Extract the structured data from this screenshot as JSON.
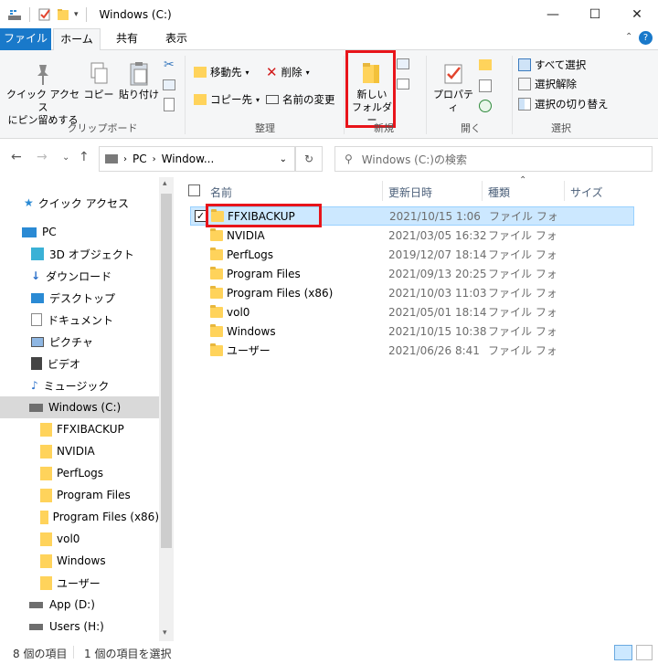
{
  "window": {
    "title": "Windows (C:)"
  },
  "tabs": {
    "file": "ファイル",
    "home": "ホーム",
    "share": "共有",
    "view": "表示"
  },
  "ribbon": {
    "clipboard": {
      "pin_line1": "クイック アクセス",
      "pin_line2": "にピン留めする",
      "copy": "コピー",
      "paste": "貼り付け",
      "label": "クリップボード"
    },
    "organize": {
      "move": "移動先",
      "copy_to": "コピー先",
      "delete": "削除",
      "rename": "名前の変更",
      "label": "整理"
    },
    "new": {
      "folder_line1": "新しい",
      "folder_line2": "フォルダー",
      "label": "新規"
    },
    "open": {
      "properties": "プロパティ",
      "label": "開く"
    },
    "select": {
      "all": "すべて選択",
      "none": "選択解除",
      "invert": "選択の切り替え",
      "label": "選択"
    }
  },
  "address": {
    "path": [
      "PC",
      "Window..."
    ],
    "search_placeholder": "Windows (C:)の検索"
  },
  "nav": {
    "quick_access": "クイック アクセス",
    "pc": "PC",
    "items": [
      "3D オブジェクト",
      "ダウンロード",
      "デスクトップ",
      "ドキュメント",
      "ピクチャ",
      "ビデオ",
      "ミュージック"
    ],
    "drive_c": "Windows (C:)",
    "drive_c_children": [
      "FFXIBACKUP",
      "NVIDIA",
      "PerfLogs",
      "Program Files",
      "Program Files (x86)",
      "vol0",
      "Windows",
      "ユーザー"
    ],
    "drive_d": "App (D:)",
    "drive_h": "Users (H:)"
  },
  "columns": {
    "name": "名前",
    "date": "更新日時",
    "type": "種類",
    "size": "サイズ"
  },
  "files": [
    {
      "name": "FFXIBACKUP",
      "date": "2021/10/15 1:06",
      "type": "ファイル フォルダー"
    },
    {
      "name": "NVIDIA",
      "date": "2021/03/05 16:32",
      "type": "ファイル フォルダー"
    },
    {
      "name": "PerfLogs",
      "date": "2019/12/07 18:14",
      "type": "ファイル フォルダー"
    },
    {
      "name": "Program Files",
      "date": "2021/09/13 20:25",
      "type": "ファイル フォルダー"
    },
    {
      "name": "Program Files (x86)",
      "date": "2021/10/03 11:03",
      "type": "ファイル フォルダー"
    },
    {
      "name": "vol0",
      "date": "2021/05/01 18:14",
      "type": "ファイル フォルダー"
    },
    {
      "name": "Windows",
      "date": "2021/10/15 10:38",
      "type": "ファイル フォルダー"
    },
    {
      "name": "ユーザー",
      "date": "2021/06/26 8:41",
      "type": "ファイル フォルダー"
    }
  ],
  "status": {
    "count": "8 個の項目",
    "selected": "1 個の項目を選択"
  },
  "colors": {
    "accent": "#1979ca",
    "highlight": "#e8141a",
    "selection": "#cce8ff",
    "folder": "#ffd35b"
  }
}
